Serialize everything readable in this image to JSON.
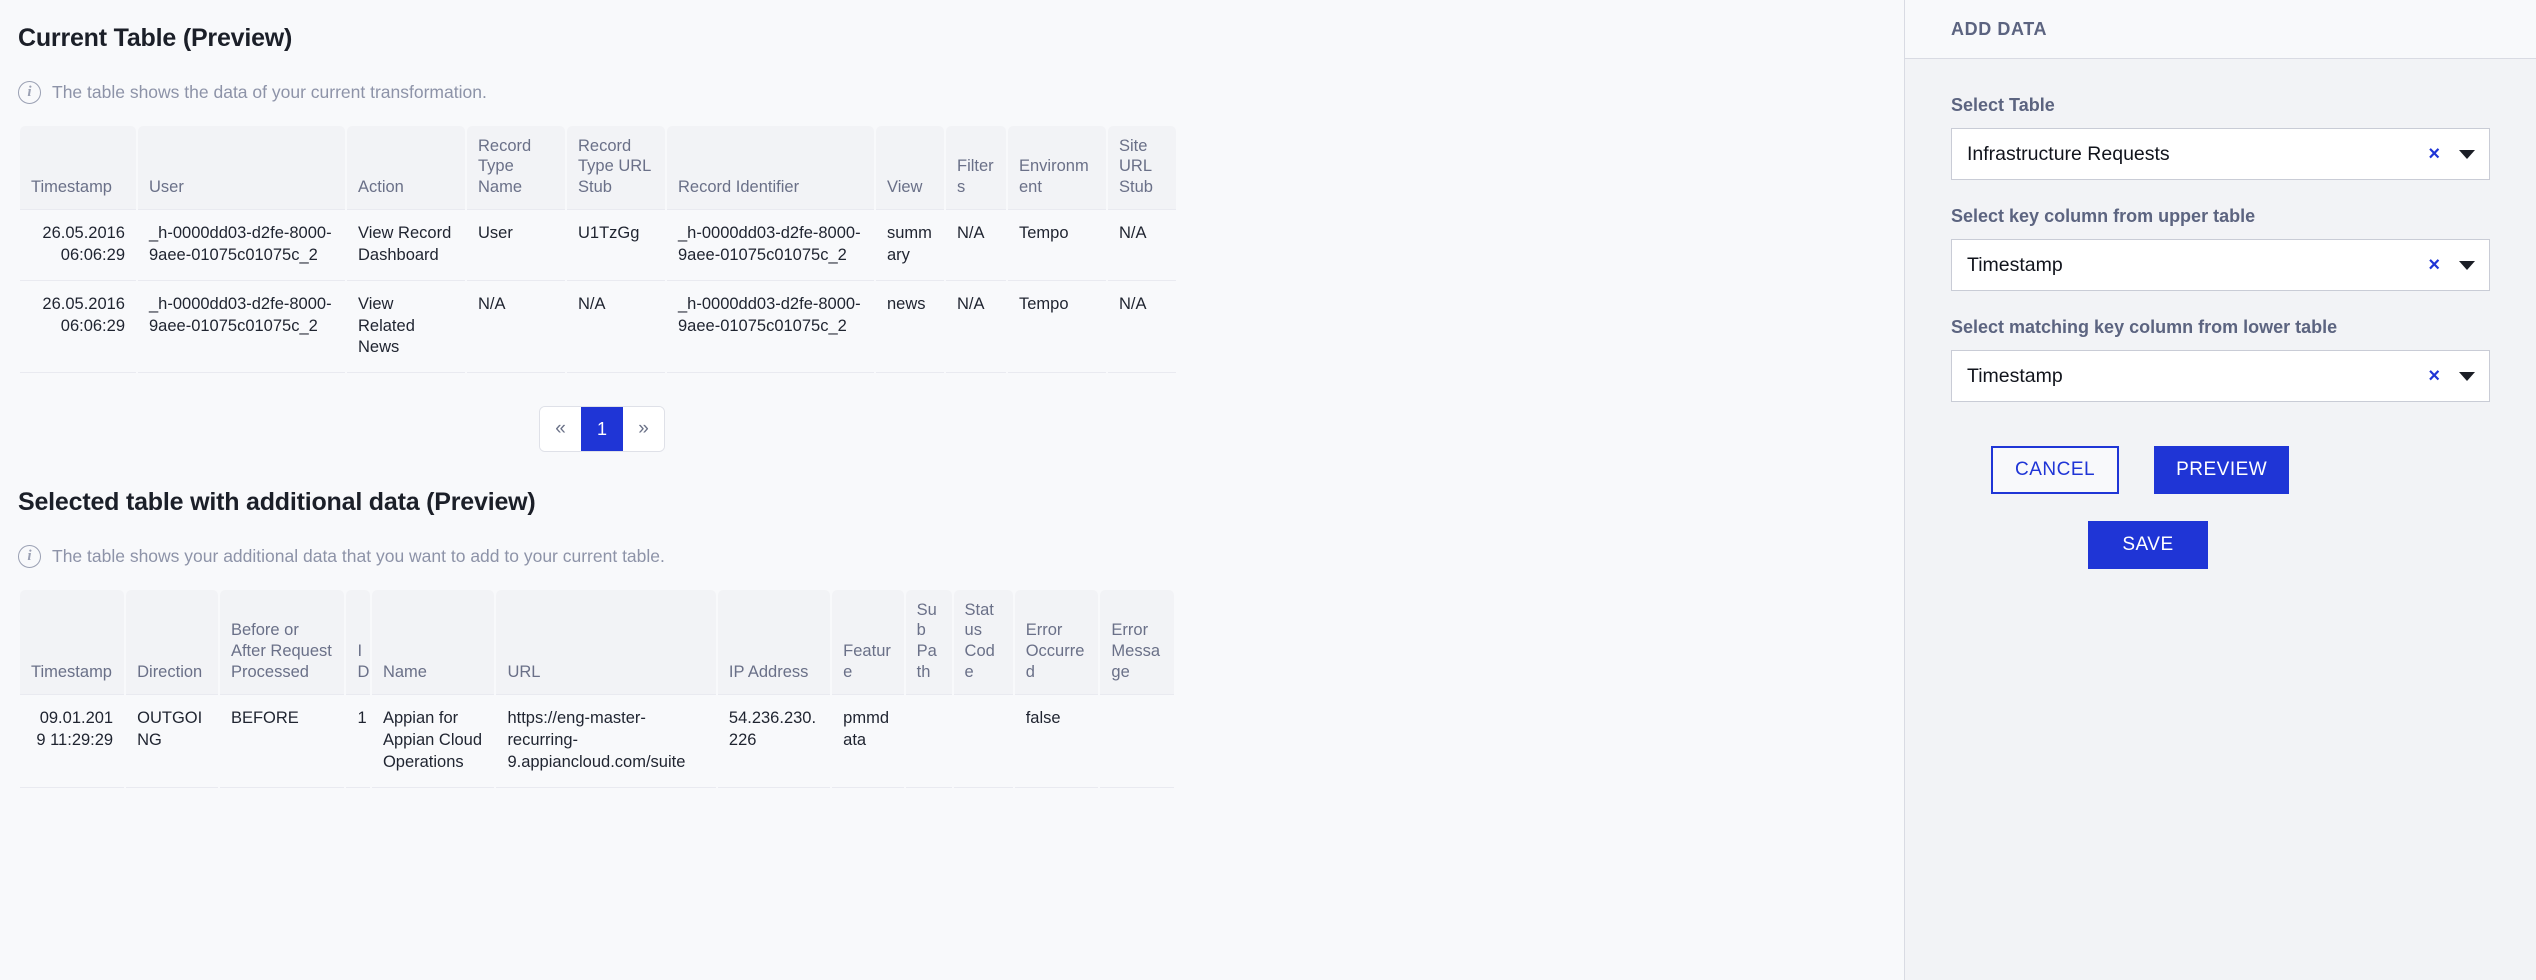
{
  "upper_section": {
    "title": "Current Table (Preview)",
    "hint": "The table shows the data of your current transformation.",
    "info_icon": "info-icon",
    "columns": [
      "Timestamp",
      "User",
      "Action",
      "Record Type Name",
      "Record Type URL Stub",
      "Record Identifier",
      "View",
      "Filters",
      "Environment",
      "Site URL Stub"
    ],
    "rows": [
      {
        "timestamp": "26.05.2016 06:06:29",
        "user": "_h-0000dd03-d2fe-8000-9aee-01075c01075c_2",
        "action": "View Record Dashboard",
        "record_type_name": "User",
        "record_type_url_stub": "U1TzGg",
        "record_identifier": "_h-0000dd03-d2fe-8000-9aee-01075c01075c_2",
        "view": "summary",
        "filters": "N/A",
        "environment": "Tempo",
        "site_url_stub": "N/A"
      },
      {
        "timestamp": "26.05.2016 06:06:29",
        "user": "_h-0000dd03-d2fe-8000-9aee-01075c01075c_2",
        "action": "View Related News",
        "record_type_name": "N/A",
        "record_type_url_stub": "N/A",
        "record_identifier": "_h-0000dd03-d2fe-8000-9aee-01075c01075c_2",
        "view": "news",
        "filters": "N/A",
        "environment": "Tempo",
        "site_url_stub": "N/A"
      }
    ]
  },
  "pagination": {
    "prev_label": "«",
    "next_label": "»",
    "current_page": "1"
  },
  "lower_section": {
    "title": "Selected table with additional data (Preview)",
    "hint": "The table shows your additional data that you want to add to your current table.",
    "info_icon": "info-icon",
    "columns": [
      "Timestamp",
      "Direction",
      "Before or After Request Processed",
      "ID",
      "Name",
      "URL",
      "IP Address",
      "Feature",
      "Sub Path",
      "Status Code",
      "Error Occurred",
      "Error Message"
    ],
    "rows": [
      {
        "timestamp": "09.01.2019 11:29:29",
        "direction": "OUTGOING",
        "before_after": "BEFORE",
        "id": "1",
        "name": "Appian for Appian Cloud Operations",
        "url": "https://eng-master-recurring-9.appiancloud.com/suite",
        "ip_address": "54.236.230.226",
        "feature": "pmmdata",
        "sub_path": "",
        "status_code": "",
        "error_occurred": "false",
        "error_message": ""
      }
    ]
  },
  "panel": {
    "title": "ADD DATA",
    "fields": [
      {
        "label": "Select Table",
        "value": "Infrastructure Requests"
      },
      {
        "label": "Select key column from upper table",
        "value": "Timestamp"
      },
      {
        "label": "Select matching key column from lower table",
        "value": "Timestamp"
      }
    ],
    "clear_glyph": "×",
    "buttons": {
      "cancel": "CANCEL",
      "preview": "PREVIEW",
      "save": "SAVE"
    }
  },
  "colors": {
    "accent": "#1f35d6",
    "header_bg": "#f2f3f6",
    "page_bg": "#f8f9fb",
    "muted_text": "#8d93a8"
  }
}
